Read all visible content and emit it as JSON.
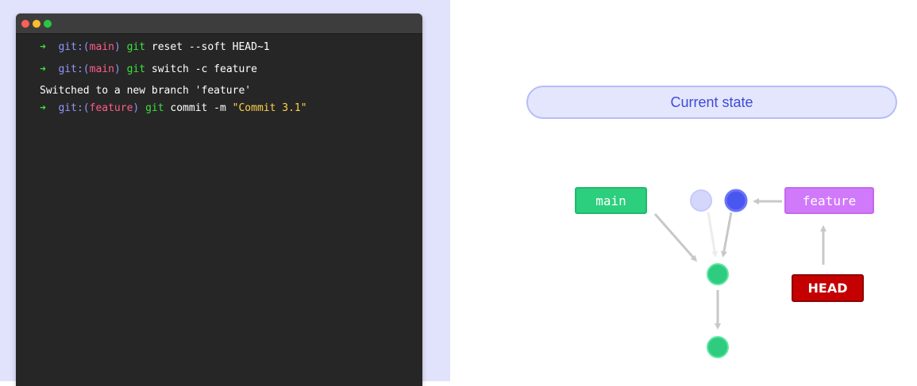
{
  "terminal": {
    "lines": [
      {
        "prompt": "➜",
        "git_label": "git:(",
        "branch": "main",
        "git_close": ")",
        "cmd": "git",
        "args": " reset --soft HEAD~1"
      },
      {
        "prompt": "➜",
        "git_label": "git:(",
        "branch": "main",
        "git_close": ")",
        "cmd": "git",
        "args": " switch -c feature"
      },
      {
        "output": "Switched to a new branch 'feature'"
      },
      {
        "prompt": "➜",
        "git_label": "git:(",
        "branch": "feature",
        "git_close": ")",
        "cmd": "git",
        "args": " commit -m ",
        "string": "\"Commit 3.1\""
      }
    ]
  },
  "diagram": {
    "state_title": "Current state",
    "labels": {
      "main": "main",
      "feature": "feature",
      "head": "HEAD"
    },
    "colors": {
      "commit_green": "#2ecc7f",
      "commit_blue": "#4a56f0",
      "commit_faded": "#d4d7fb",
      "arrow": "#c8c8c8",
      "main_label": "#2bcf7e",
      "feature_label": "#d179fb",
      "head_label": "#c40000"
    }
  }
}
